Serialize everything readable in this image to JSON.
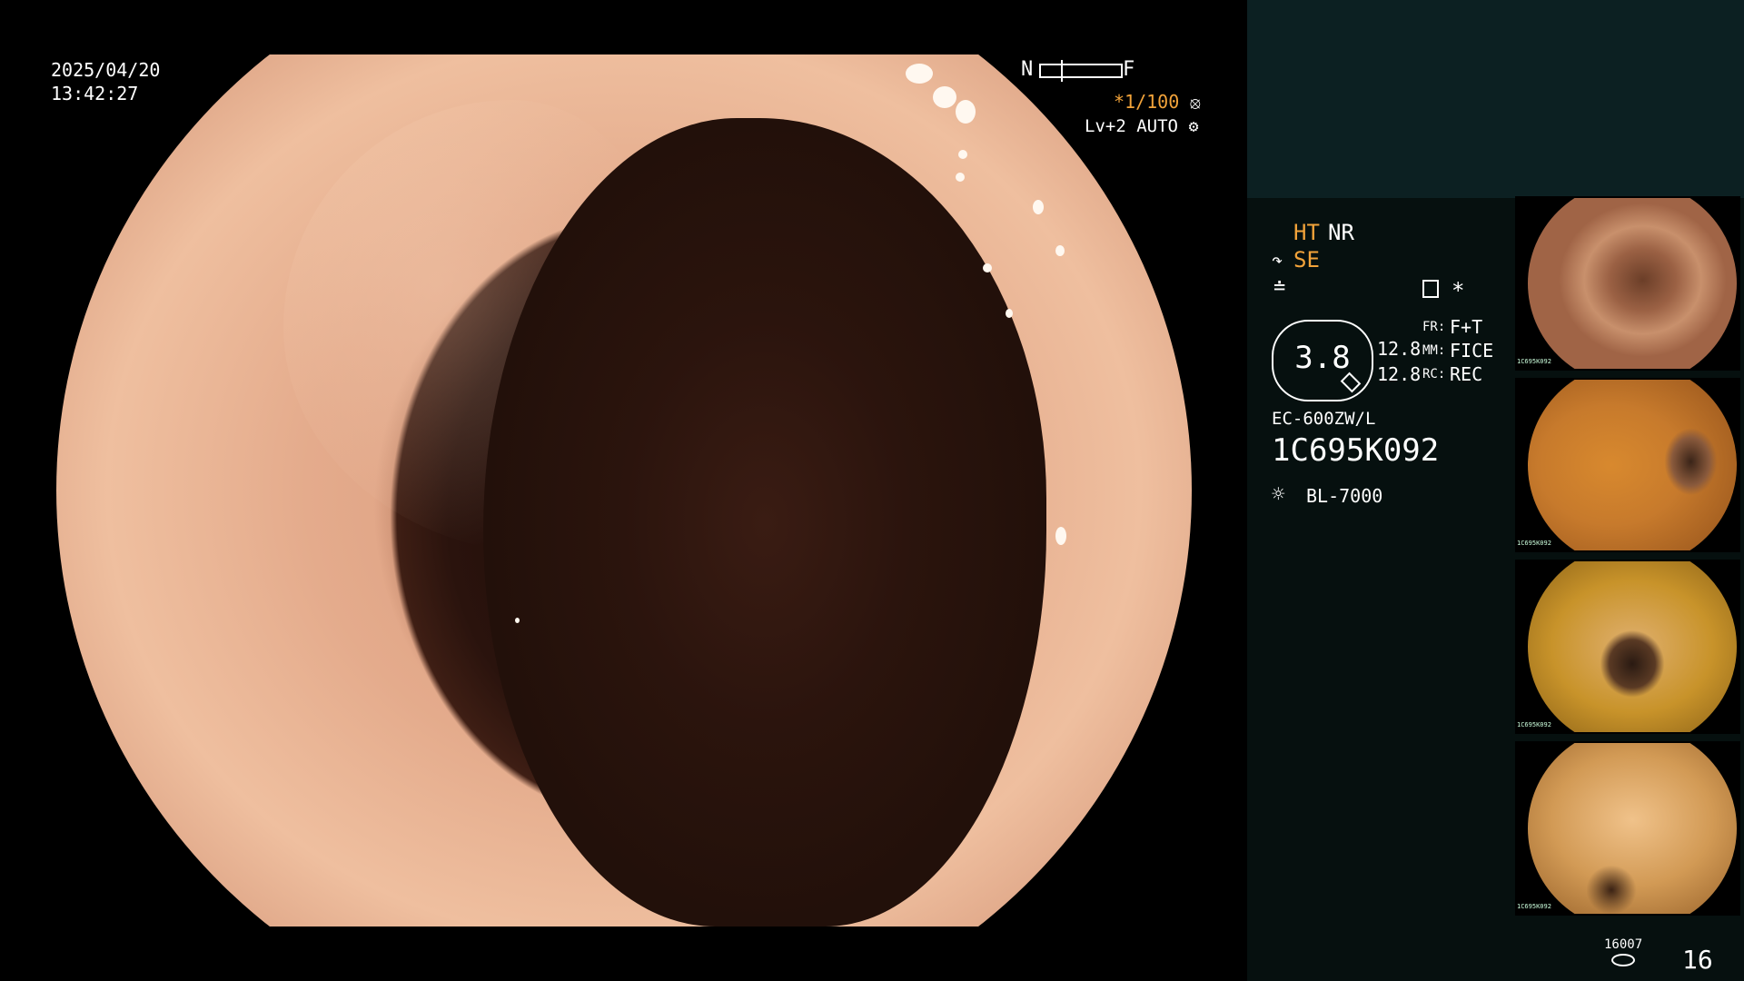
{
  "overlay": {
    "date": "2025/04/20",
    "time": "13:42:27",
    "focus_near": "N",
    "focus_far": "F",
    "shutter": "*1/100",
    "shutter_icon": "aperture-icon",
    "level": "Lv+2 AUTO",
    "level_icon": "gear-icon"
  },
  "panel": {
    "ht_label": "HT",
    "nr_label": "NR",
    "se_label": "SE",
    "zoom_value": "3.8",
    "fr_value1": "12.8",
    "fr_value2": "12.8",
    "fr_label": "FR:",
    "fr_mode": "F+T",
    "mm_label": "MM:",
    "mm_mode": "FICE",
    "rc_label": "RC:",
    "rc_mode": "REC",
    "asterisk": "*",
    "scope_model": "EC-600ZW/L",
    "serial": "1C695K092",
    "light_source": "BL-7000",
    "storage_count": "16007",
    "image_count": "16"
  },
  "thumbnails": [
    {
      "label": "thumbnail 1",
      "tag": "1C695K092",
      "tone": "#b27a5c"
    },
    {
      "label": "thumbnail 2",
      "tag": "1C695K092",
      "tone": "#c77a2c"
    },
    {
      "label": "thumbnail 3",
      "tag": "1C695K092",
      "tone": "#c8932a"
    },
    {
      "label": "thumbnail 4",
      "tag": "1C695K092",
      "tone": "#d29a55"
    }
  ],
  "colors": {
    "accent_orange": "#f2a33a",
    "panel_bg": "#06100f",
    "panel_top_bg": "#0c2022"
  }
}
